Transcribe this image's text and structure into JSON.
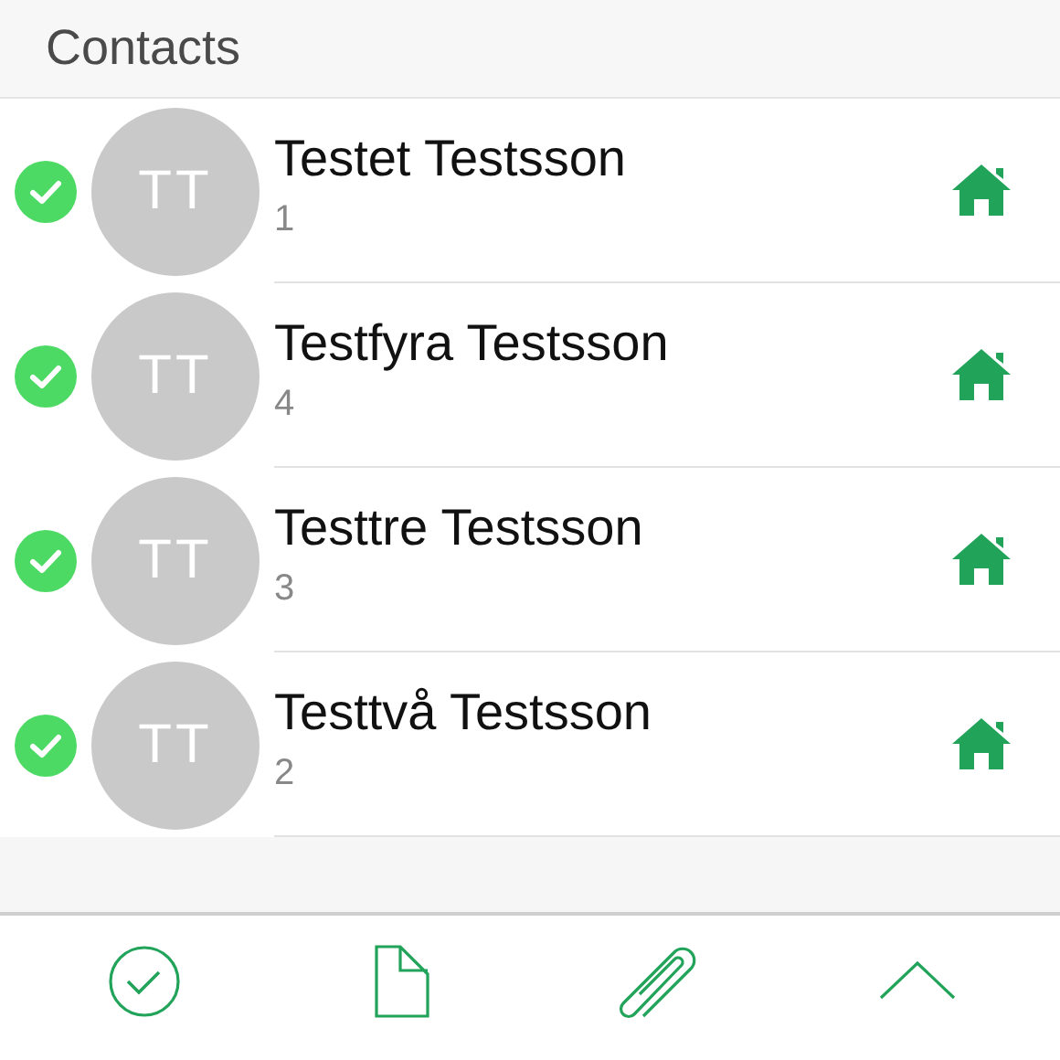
{
  "header": {
    "title": "Contacts"
  },
  "contacts": [
    {
      "name": "Testet Testsson",
      "number": "1",
      "initials": "TT",
      "checked": true
    },
    {
      "name": "Testfyra Testsson",
      "number": "4",
      "initials": "TT",
      "checked": true
    },
    {
      "name": "Testtre Testsson",
      "number": "3",
      "initials": "TT",
      "checked": true
    },
    {
      "name": "Testtvå Testsson",
      "number": "2",
      "initials": "TT",
      "checked": true
    }
  ],
  "toolbar": [
    {
      "kind": "check"
    },
    {
      "kind": "document"
    },
    {
      "kind": "paperclip"
    },
    {
      "kind": "chevron-up"
    }
  ]
}
